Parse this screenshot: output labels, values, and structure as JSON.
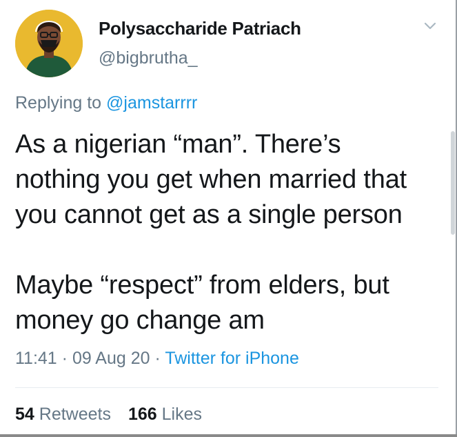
{
  "user": {
    "display_name": "Polysaccharide Patriach",
    "handle": "@bigbrutha_",
    "avatar_icon": "avatar-cartoon-man-icon",
    "avatar_bg": "#e9b92f"
  },
  "reply": {
    "prefix": "Replying to ",
    "handle": "@jamstarrrr"
  },
  "body": {
    "lines": [
      "As a nigerian “man”. There’s",
      "nothing you get when married that",
      "you cannot get as a single person",
      "Maybe “respect” from elders, but",
      "money go change am"
    ]
  },
  "meta": {
    "time": "11:41",
    "sep1": " · ",
    "date": "09 Aug 20",
    "sep2": " · ",
    "source": "Twitter for iPhone"
  },
  "stats": {
    "retweets_count": "54",
    "retweets_label": "Retweets",
    "likes_count": "166",
    "likes_label": "Likes"
  },
  "colors": {
    "link": "#1b95e0",
    "secondary_text": "#657786",
    "primary_text": "#14171a"
  },
  "icons": {
    "menu": "chevron-down-icon"
  }
}
